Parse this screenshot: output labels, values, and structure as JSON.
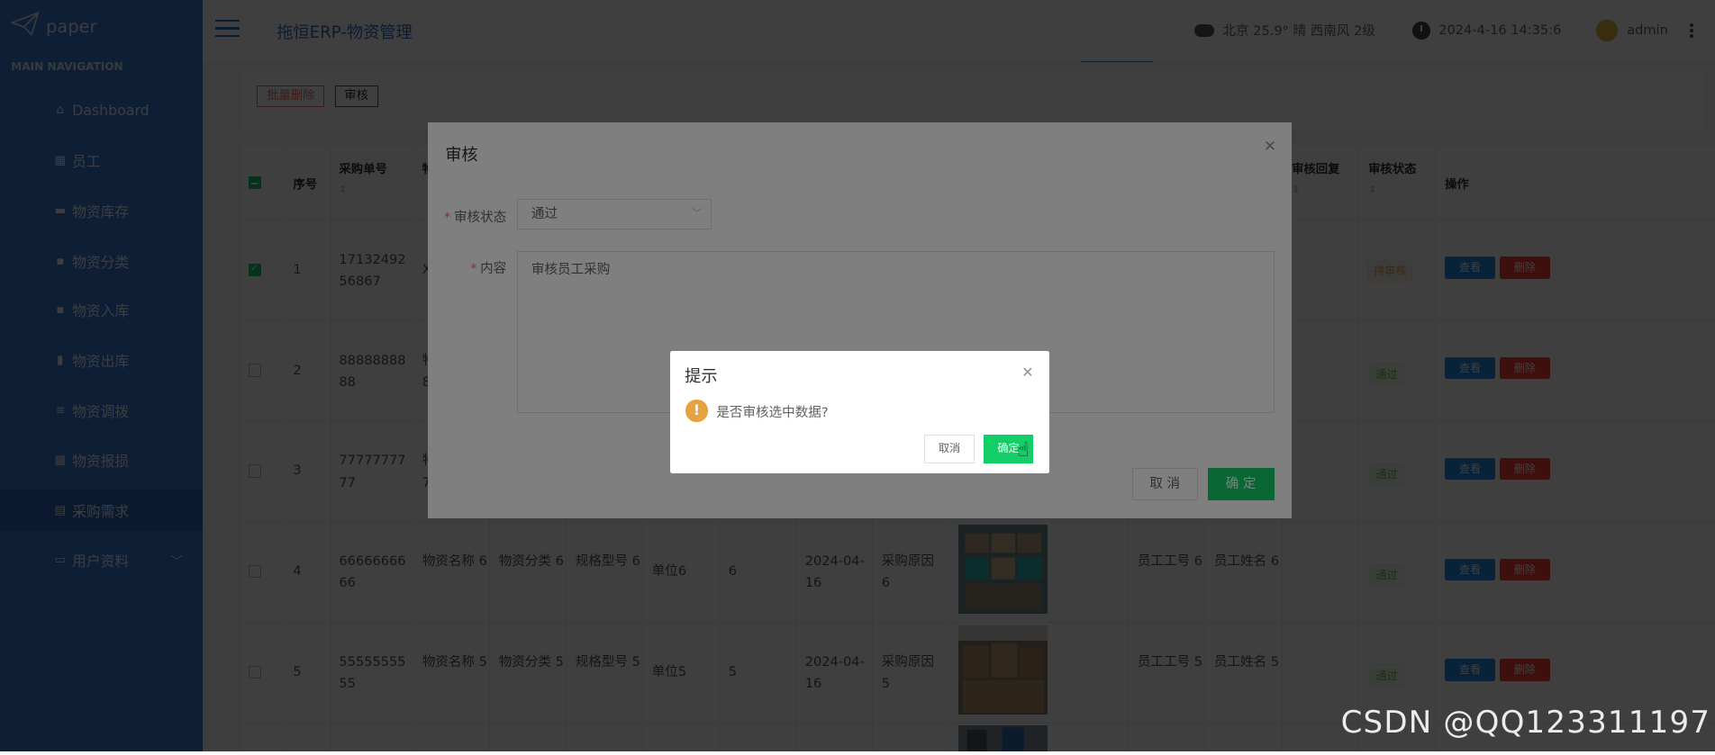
{
  "sidebar": {
    "logo": "paper",
    "heading": "MAIN NAVIGATION",
    "items": [
      {
        "icon": "home-icon",
        "glyph": "⌂",
        "label": "Dashboard"
      },
      {
        "icon": "grid-icon",
        "glyph": "▦",
        "label": "员工"
      },
      {
        "icon": "tag-icon",
        "glyph": "▬",
        "label": "物资库存"
      },
      {
        "icon": "comment-icon",
        "glyph": "▪",
        "label": "物资分类"
      },
      {
        "icon": "comment-icon",
        "glyph": "▪",
        "label": "物资入库"
      },
      {
        "icon": "bar-chart-icon",
        "glyph": "▮",
        "label": "物资出库"
      },
      {
        "icon": "list-icon",
        "glyph": "≡",
        "label": "物资调拨"
      },
      {
        "icon": "grid-icon",
        "glyph": "▦",
        "label": "物资报损"
      },
      {
        "icon": "clipboard-icon",
        "glyph": "▤",
        "label": "采购需求"
      },
      {
        "icon": "calendar-icon",
        "glyph": "▭",
        "label": "用户资料"
      }
    ]
  },
  "header": {
    "title": "拖恒ERP-物资管理",
    "weather": "北京 25.9° 晴 西南风 2级",
    "datetime": "2024-4-16 14:35:6",
    "user": "admin"
  },
  "toolbar": {
    "batch_delete": "批量删除",
    "audit": "审核"
  },
  "table": {
    "headers": {
      "index": "序号",
      "order_no": "采购单号",
      "audit_reply": "审核回复",
      "audit_status": "审核状态",
      "actions": "操作"
    },
    "rows": [
      {
        "index": "1",
        "order_no": "17132492 56867",
        "status": "待审核"
      },
      {
        "index": "2",
        "order_no": "88888888 88",
        "status": "通过"
      },
      {
        "index": "3",
        "order_no": "77777777 77",
        "status": "通过"
      },
      {
        "index": "4",
        "order_no": "66666666 66",
        "name": "物资名称 6",
        "category": "物资分类 6",
        "spec": "规格型号 6",
        "unit": "单位6",
        "qty": "6",
        "date": "2024-04- 16",
        "reason": "采购原因 6",
        "emp_no": "员工工号 6",
        "emp_name": "员工姓名 6",
        "status": "通过"
      },
      {
        "index": "5",
        "order_no": "55555555 55",
        "name": "物资名称 5",
        "category": "物资分类 5",
        "spec": "规格型号 5",
        "unit": "单位5",
        "qty": "5",
        "date": "2024-04- 16",
        "reason": "采购原因 5",
        "emp_no": "员工工号 5",
        "emp_name": "员工姓名 5",
        "status": "通过"
      }
    ],
    "view_label": "查看",
    "delete_label": "删除",
    "partial_col_glyphs": [
      "物",
      "X",
      "物 8",
      "物 7"
    ]
  },
  "audit_dialog": {
    "title": "审核",
    "status_label": "审核状态",
    "status_value": "通过",
    "content_label": "内容",
    "content_value": "审核员工采购",
    "cancel": "取 消",
    "confirm": "确 定"
  },
  "confirm_box": {
    "title": "提示",
    "message": "是否审核选中数据?",
    "cancel": "取消",
    "confirm": "确定"
  },
  "watermark": "CSDN @QQ123311197",
  "colors": {
    "sidebar": "#3a7bd5",
    "accent": "#2b73c9",
    "primary_green": "#13ce66",
    "view_blue": "#1e88e5",
    "delete_red": "#f44336"
  }
}
